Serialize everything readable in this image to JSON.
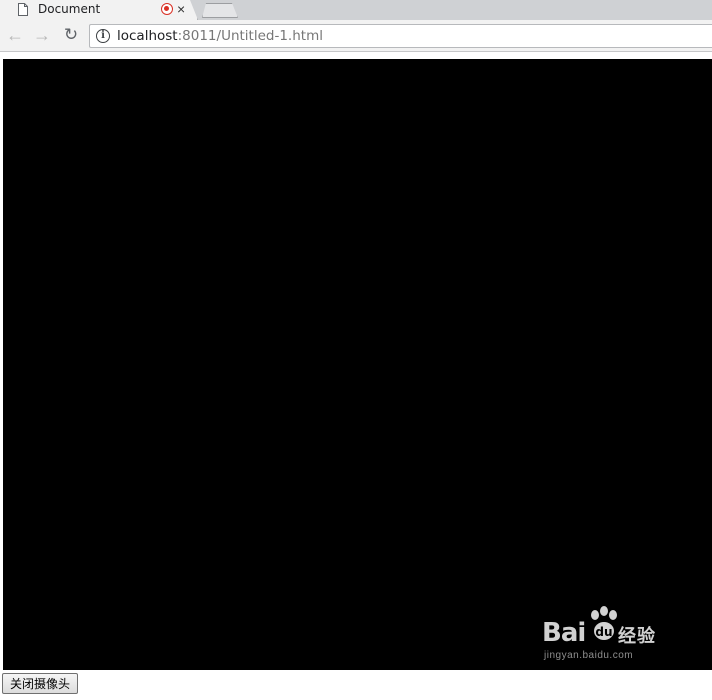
{
  "browser": {
    "tab": {
      "title": "Document",
      "close_glyph": "×",
      "page_icon": "document-icon",
      "recording_indicator": "recording-icon"
    },
    "toolbar": {
      "back_glyph": "←",
      "forward_glyph": "→",
      "reload_glyph": "↻",
      "info_glyph": "i",
      "url_host": "localhost",
      "url_rest": ":8011/Untitled-1.html"
    }
  },
  "page": {
    "video": {
      "background": "#000000"
    },
    "watermark": {
      "brand_left": "Bai",
      "brand_right": "经验",
      "subtext": "jingyan.baidu.com"
    },
    "close_camera_button": "关闭摄像头"
  },
  "colors": {
    "recording": "#d93025",
    "chrome_bg": "#f2f2f2",
    "tabstrip_bg": "#cfd1d4"
  }
}
